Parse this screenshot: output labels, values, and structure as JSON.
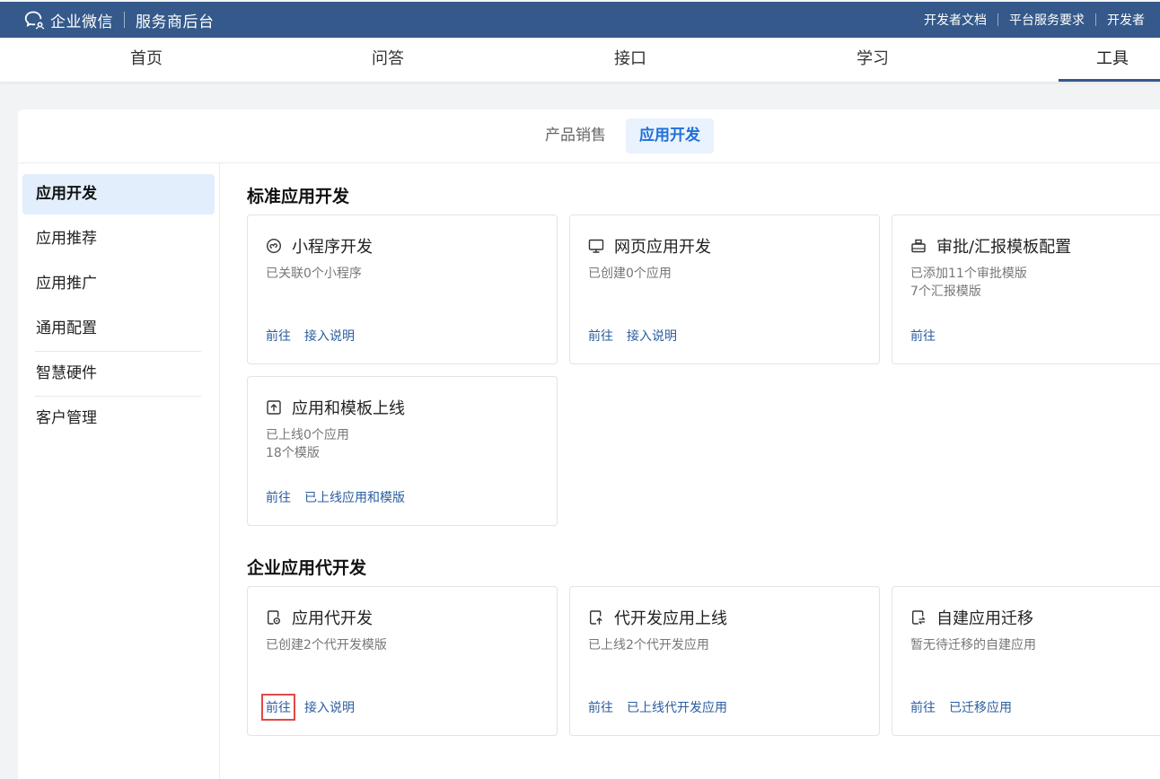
{
  "topbar": {
    "brand_name": "企业微信",
    "brand_sub": "服务商后台",
    "links": [
      "开发者文档",
      "平台服务要求",
      "开发者"
    ]
  },
  "nav": {
    "items": [
      "首页",
      "问答",
      "接口",
      "学习",
      "工具"
    ],
    "active": "工具"
  },
  "subtabs": {
    "items": [
      "产品销售",
      "应用开发"
    ],
    "active": "应用开发"
  },
  "sidebar": {
    "items": [
      "应用开发",
      "应用推荐",
      "应用推广",
      "通用配置",
      "智慧硬件",
      "客户管理"
    ],
    "active": "应用开发"
  },
  "sections": [
    {
      "title": "标准应用开发",
      "cards": [
        {
          "icon": "mini-program-icon",
          "title": "小程序开发",
          "desc": [
            "已关联0个小程序"
          ],
          "links": [
            "前往",
            "接入说明"
          ]
        },
        {
          "icon": "monitor-icon",
          "title": "网页应用开发",
          "desc": [
            "已创建0个应用"
          ],
          "links": [
            "前往",
            "接入说明"
          ]
        },
        {
          "icon": "stamp-icon",
          "title": "审批/汇报模板配置",
          "desc": [
            "已添加11个审批模版",
            "7个汇报模版"
          ],
          "links": [
            "前往"
          ]
        },
        {
          "icon": "upload-icon",
          "title": "应用和模板上线",
          "desc": [
            "已上线0个应用",
            "18个模版"
          ],
          "links": [
            "前往",
            "已上线应用和模版"
          ]
        }
      ]
    },
    {
      "title": "企业应用代开发",
      "cards": [
        {
          "icon": "dev-template-icon",
          "title": "应用代开发",
          "desc": [
            "已创建2个代开发模版"
          ],
          "links": [
            "前往",
            "接入说明"
          ]
        },
        {
          "icon": "publish-icon",
          "title": "代开发应用上线",
          "desc": [
            "已上线2个代开发应用"
          ],
          "links": [
            "前往",
            "已上线代开发应用"
          ]
        },
        {
          "icon": "migrate-icon",
          "title": "自建应用迁移",
          "desc": [
            "暂无待迁移的自建应用"
          ],
          "links": [
            "前往",
            "已迁移应用"
          ]
        }
      ]
    }
  ],
  "colors": {
    "topbar_bg": "#34598a",
    "link": "#2a5d9f",
    "active_tab_text": "#1f6fd8",
    "active_tab_bg": "#e9f2fd",
    "highlight_box": "#e04848"
  }
}
